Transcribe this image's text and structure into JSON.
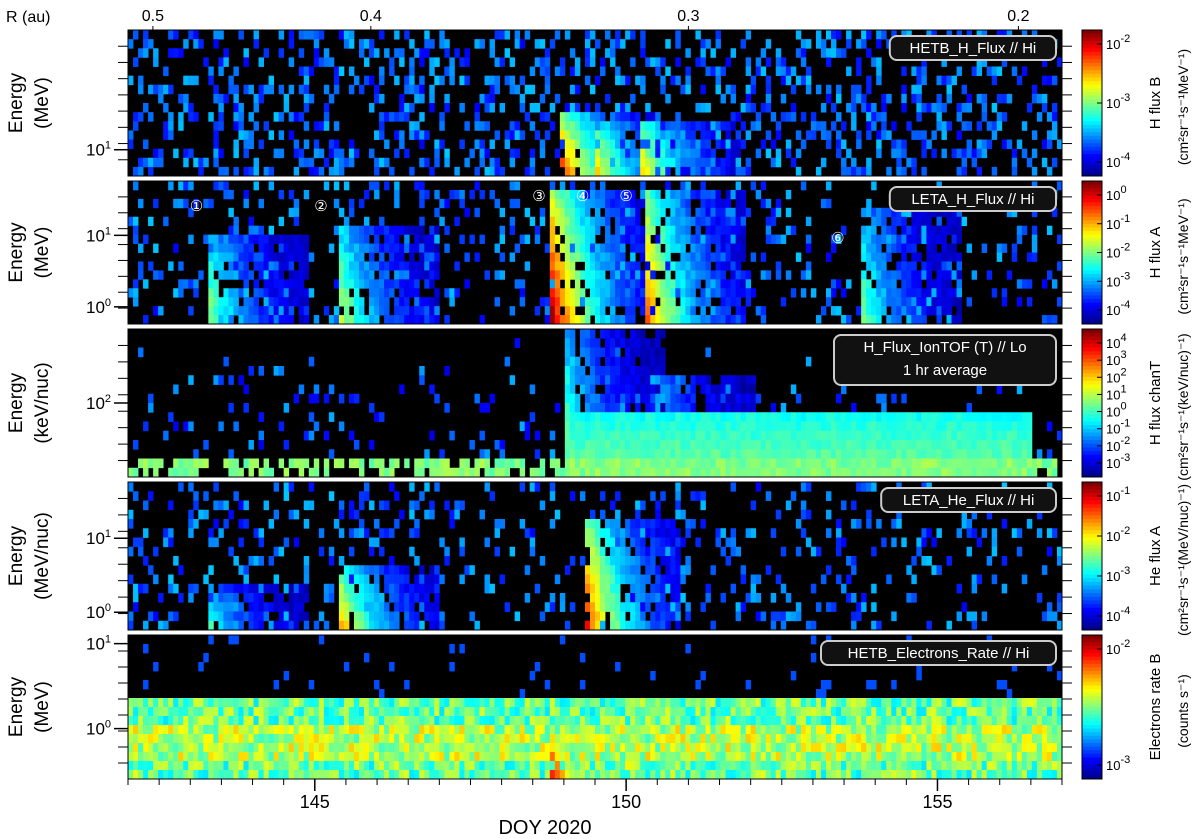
{
  "figure": {
    "top_axis_label": "R (au)",
    "top_ticks": [
      {
        "label": "0.5",
        "doy": 142.4
      },
      {
        "label": "0.4",
        "doy": 145.9
      },
      {
        "label": "0.3",
        "doy": 151.0
      },
      {
        "label": "0.2",
        "doy": 156.3
      }
    ],
    "xlabel": "DOY 2020",
    "x_range": [
      142.0,
      157.0
    ],
    "x_ticks": [
      145,
      150,
      155
    ]
  },
  "colors": {
    "background_data": "#000000",
    "colormap": [
      "#00008f",
      "#0000ff",
      "#0080ff",
      "#00ffff",
      "#80ff80",
      "#ffff00",
      "#ff8000",
      "#ff0000",
      "#800000"
    ],
    "tag_border": "#cccccc"
  },
  "chart_data": [
    {
      "type": "heatmap",
      "title": "HETB_H_Flux // Hi",
      "ylabel": [
        "Energy",
        "(MeV)"
      ],
      "y_ticks": [
        {
          "label": "10",
          "exp": "1"
        }
      ],
      "colorbar_label": "H flux B",
      "colorbar_unit": "(cm²sr⁻¹s⁻¹MeV⁻¹)",
      "colorbar_ticks": [
        {
          "label": "10",
          "exp": "-2"
        },
        {
          "label": "10",
          "exp": "-3"
        },
        {
          "label": "10",
          "exp": "-4"
        }
      ],
      "events": [
        {
          "doy": 148.9,
          "intensity": 0.95,
          "top": 0.55
        },
        {
          "doy": 149.5,
          "intensity": 0.7,
          "top": 0.6
        },
        {
          "doy": 150.2,
          "intensity": 0.75,
          "top": 0.6
        }
      ],
      "annotations": []
    },
    {
      "type": "heatmap",
      "title": "LETA_H_Flux // Hi",
      "ylabel": [
        "Energy",
        "(MeV)"
      ],
      "y_ticks": [
        {
          "label": "10",
          "exp": "1"
        },
        {
          "label": "10",
          "exp": "0"
        }
      ],
      "colorbar_label": "H flux A",
      "colorbar_unit": "(cm²sr⁻¹s⁻¹MeV⁻¹)",
      "colorbar_ticks": [
        {
          "label": "10",
          "exp": "0"
        },
        {
          "label": "10",
          "exp": "-1"
        },
        {
          "label": "10",
          "exp": "-2"
        },
        {
          "label": "10",
          "exp": "-3"
        },
        {
          "label": "10",
          "exp": "-4"
        }
      ],
      "events": [
        {
          "doy": 143.3,
          "intensity": 0.55,
          "top": 0.35
        },
        {
          "doy": 145.4,
          "intensity": 0.6,
          "top": 0.3
        },
        {
          "doy": 148.8,
          "intensity": 1.0,
          "top": 0.05
        },
        {
          "doy": 150.3,
          "intensity": 0.85,
          "top": 0.05
        },
        {
          "doy": 153.8,
          "intensity": 0.5,
          "top": 0.2
        }
      ],
      "annotations": [
        {
          "label": "①",
          "doy": 143.1
        },
        {
          "label": "②",
          "doy": 145.1
        },
        {
          "label": "③",
          "doy": 148.6
        },
        {
          "label": "④",
          "doy": 149.3
        },
        {
          "label": "⑤",
          "doy": 150.0
        },
        {
          "label": "⑥",
          "doy": 153.4
        }
      ]
    },
    {
      "type": "heatmap",
      "title": "H_Flux_IonTOF (T) // Lo",
      "subtitle": "1 hr average",
      "ylabel": [
        "Energy",
        "(keV/nuc)"
      ],
      "y_ticks": [
        {
          "label": "10",
          "exp": "2"
        }
      ],
      "colorbar_label": "H flux chanT",
      "colorbar_unit": "(cm²sr⁻¹s⁻¹(keV/nuc)⁻¹)",
      "colorbar_ticks": [
        {
          "label": "10",
          "exp": "4"
        },
        {
          "label": "10",
          "exp": "3"
        },
        {
          "label": "10",
          "exp": "2"
        },
        {
          "label": "10",
          "exp": "1"
        },
        {
          "label": "10",
          "exp": "0"
        },
        {
          "label": "10",
          "exp": "-1"
        },
        {
          "label": "10",
          "exp": "-2"
        },
        {
          "label": "10",
          "exp": "-3"
        }
      ],
      "events": [
        {
          "doy": 149.0,
          "intensity": 0.55,
          "top": 0.0
        },
        {
          "doy": 150.5,
          "intensity": 0.45,
          "top": 0.3
        }
      ],
      "annotations": []
    },
    {
      "type": "heatmap",
      "title": "LETA_He_Flux // Hi",
      "ylabel": [
        "Energy",
        "(MeV/nuc)"
      ],
      "y_ticks": [
        {
          "label": "10",
          "exp": "1"
        },
        {
          "label": "10",
          "exp": "0"
        }
      ],
      "colorbar_label": "He flux A",
      "colorbar_unit": "(cm²sr⁻¹s⁻¹(MeV/nuc)⁻¹)",
      "colorbar_ticks": [
        {
          "label": "10",
          "exp": "-1"
        },
        {
          "label": "10",
          "exp": "-2"
        },
        {
          "label": "10",
          "exp": "-3"
        },
        {
          "label": "10",
          "exp": "-4"
        }
      ],
      "events": [
        {
          "doy": 143.3,
          "intensity": 0.45,
          "top": 0.7
        },
        {
          "doy": 145.4,
          "intensity": 0.75,
          "top": 0.55
        },
        {
          "doy": 149.3,
          "intensity": 0.95,
          "top": 0.25
        }
      ],
      "annotations": []
    },
    {
      "type": "heatmap",
      "title": "HETB_Electrons_Rate // Hi",
      "ylabel": [
        "Energy",
        "(MeV)"
      ],
      "y_ticks": [
        {
          "label": "10",
          "exp": "1"
        },
        {
          "label": "10",
          "exp": "0"
        }
      ],
      "colorbar_label": "Electrons rate B",
      "colorbar_unit": "(counts s⁻¹)",
      "colorbar_ticks": [
        {
          "label": "10",
          "exp": "-2"
        },
        {
          "label": "10",
          "exp": "-3"
        }
      ],
      "events": [
        {
          "doy": 148.8,
          "intensity": 0.9,
          "top": 0.6
        },
        {
          "doy": 150.0,
          "intensity": 0.7,
          "top": 0.6
        }
      ],
      "annotations": []
    }
  ]
}
